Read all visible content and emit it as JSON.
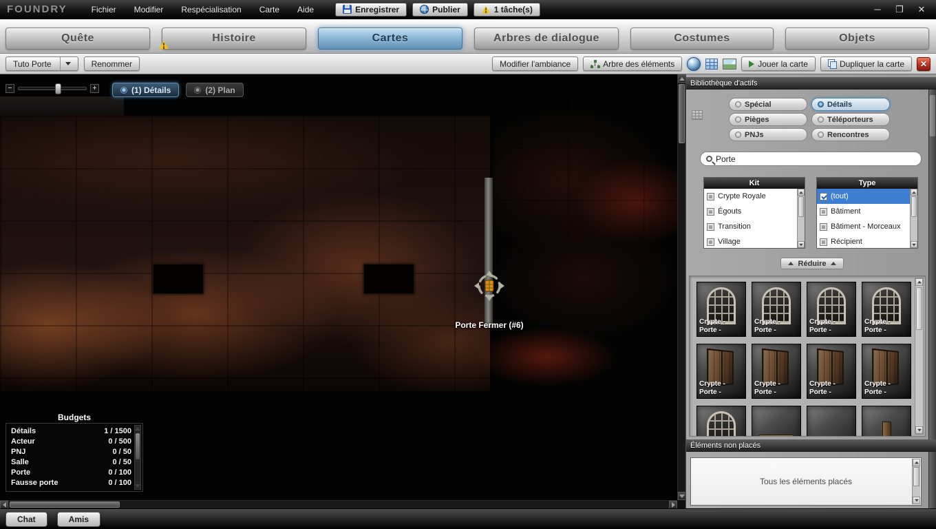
{
  "icons": {
    "minimize": "─",
    "restore": "❐",
    "close": "✕",
    "close_map": "✕",
    "zoom_out": "−",
    "zoom_in": "+"
  },
  "colors": {
    "accent_blue": "#3d7dd2",
    "active_tab_blue": "#8fb9d8",
    "warning_yellow": "#f2c21a",
    "danger_red": "#c23624",
    "play_green": "#2e8a2e"
  },
  "menubar": {
    "logo": "FOUNDRY",
    "items": [
      {
        "label": "Fichier"
      },
      {
        "label": "Modifier"
      },
      {
        "label": "Respécialisation"
      },
      {
        "label": "Carte"
      },
      {
        "label": "Aide"
      }
    ],
    "save_label": "Enregistrer",
    "publish_label": "Publier",
    "tasks_label": "1 tâche(s)"
  },
  "tabs": [
    {
      "label": "Quête"
    },
    {
      "label": "Histoire"
    },
    {
      "label": "Cartes"
    },
    {
      "label": "Arbres de dialogue"
    },
    {
      "label": "Costumes"
    },
    {
      "label": "Objets"
    }
  ],
  "toolbar": {
    "map_name": "Tuto Porte",
    "rename_label": "Renommer",
    "ambiance_label": "Modifier l'ambiance",
    "tree_label": "Arbre des éléments",
    "play_label": "Jouer la carte",
    "duplicate_label": "Dupliquer la carte"
  },
  "canvas": {
    "view_tabs": [
      {
        "label": "(1) Détails"
      },
      {
        "label": "(2) Plan"
      }
    ],
    "selection_label": "Porte Fermer (#6)",
    "budgets": {
      "title": "Budgets",
      "rows": [
        {
          "name": "Détails",
          "value": "1 / 1500"
        },
        {
          "name": "Acteur",
          "value": "0 / 500"
        },
        {
          "name": "PNJ",
          "value": "0 / 50"
        },
        {
          "name": "Salle",
          "value": "0 / 50"
        },
        {
          "name": "Porte",
          "value": "0 / 100"
        },
        {
          "name": "Fausse porte",
          "value": "0 / 100"
        }
      ]
    }
  },
  "library": {
    "title": "Bibliothèque d'actifs",
    "categories": [
      {
        "label": "Spécial"
      },
      {
        "label": "Détails"
      },
      {
        "label": "Pièges"
      },
      {
        "label": "Téléporteurs"
      },
      {
        "label": "PNJs"
      },
      {
        "label": "Rencontres"
      }
    ],
    "search": {
      "value": "Porte"
    },
    "kit_list": {
      "header": "Kit",
      "items": [
        {
          "label": "Crypte Royale"
        },
        {
          "label": "Égouts"
        },
        {
          "label": "Transition"
        },
        {
          "label": "Village"
        }
      ]
    },
    "type_list": {
      "header": "Type",
      "items": [
        {
          "label": "(tout)"
        },
        {
          "label": "Bâtiment"
        },
        {
          "label": "Bâtiment - Morceaux"
        },
        {
          "label": "Récipient"
        }
      ]
    },
    "collapse_label": "Réduire",
    "assets": [
      {
        "line1": "Crypte -",
        "line2": "Porte -"
      },
      {
        "line1": "Crypte -",
        "line2": "Porte -"
      },
      {
        "line1": "Crypte -",
        "line2": "Porte -"
      },
      {
        "line1": "Crypte -",
        "line2": "Porte -"
      },
      {
        "line1": "Crypte -",
        "line2": "Porte -"
      },
      {
        "line1": "Crypte -",
        "line2": "Porte -"
      },
      {
        "line1": "Crypte -",
        "line2": "Porte -"
      },
      {
        "line1": "Crypte -",
        "line2": "Porte -"
      },
      {
        "line1": "",
        "line2": ""
      },
      {
        "line1": "",
        "line2": ""
      },
      {
        "line1": "",
        "line2": ""
      },
      {
        "line1": "",
        "line2": ""
      }
    ]
  },
  "unplaced": {
    "title": "Éléments non placés",
    "empty_text": "Tous les éléments placés"
  },
  "social": {
    "chat_label": "Chat",
    "friends_label": "Amis"
  }
}
